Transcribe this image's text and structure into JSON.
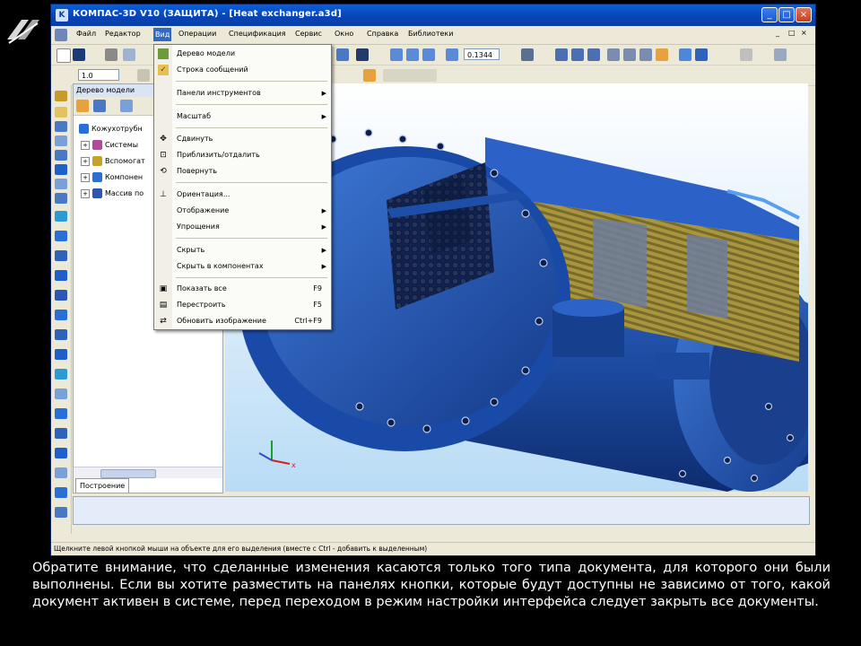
{
  "window": {
    "title": "КОМПАС-3D V10 (ЗАЩИТА) - [Heat exchanger.a3d]",
    "controls": [
      "_",
      "□",
      "×"
    ]
  },
  "menubar": {
    "items": [
      {
        "label": "Файл"
      },
      {
        "label": "Редактор"
      },
      {
        "label": "Вид"
      },
      {
        "label": "Операции"
      },
      {
        "label": "Спецификация"
      },
      {
        "label": "Сервис"
      },
      {
        "label": "Окно"
      },
      {
        "label": "Справка"
      },
      {
        "label": "Библиотеки"
      }
    ],
    "mdi_controls": [
      "_",
      "□",
      "×"
    ]
  },
  "toolbar": {
    "scale_value": "0.1344",
    "step_value": "1.0"
  },
  "tree_panel": {
    "title": "Дерево модели",
    "root": "Кожухотрубн",
    "nodes": [
      {
        "label": "Системы",
        "icon_color": "#b04a9a"
      },
      {
        "label": "Вспомогат",
        "icon_color": "#c7a12a"
      },
      {
        "label": "Компонен",
        "icon_color": "#2a6fd6"
      },
      {
        "label": "Массив по",
        "icon_color": "#2d55b3"
      }
    ],
    "tab": "Построение"
  },
  "view_menu": {
    "groups": [
      [
        {
          "label": "Дерево модели",
          "icon": "tree-icon",
          "checked": false
        },
        {
          "label": "Строка сообщений",
          "icon": "check-icon",
          "checked": true
        }
      ],
      [
        {
          "label": "Панели инструментов",
          "submenu": true
        }
      ],
      [
        {
          "label": "Масштаб",
          "submenu": true
        }
      ],
      [
        {
          "label": "Сдвинуть",
          "icon": "move-icon",
          "glyph": "✥"
        },
        {
          "label": "Приблизить/отдалить",
          "icon": "zoom-icon",
          "glyph": "⊡"
        },
        {
          "label": "Повернуть",
          "icon": "rotate-icon",
          "glyph": "⟲"
        }
      ],
      [
        {
          "label": "Ориентация...",
          "icon": "axes-icon",
          "glyph": "⊥"
        },
        {
          "label": "Отображение",
          "submenu": true
        },
        {
          "label": "Упрощения",
          "submenu": true
        }
      ],
      [
        {
          "label": "Скрыть",
          "submenu": true
        },
        {
          "label": "Скрыть в компонентах",
          "submenu": true
        }
      ],
      [
        {
          "label": "Показать все",
          "shortcut": "F9",
          "icon": "show-all-icon",
          "glyph": "▣"
        },
        {
          "label": "Перестроить",
          "shortcut": "F5",
          "icon": "rebuild-icon",
          "glyph": "▤"
        },
        {
          "label": "Обновить изображение",
          "shortcut": "Ctrl+F9",
          "icon": "refresh-icon",
          "glyph": "⇄"
        }
      ]
    ]
  },
  "status_bar": {
    "text": "Щелкните левой кнопкой мыши на объекте для его выделения (вместе с Ctrl - добавить к выделенным)"
  },
  "caption": {
    "text": "Обратите внимание, что сделанные изменения касаются только того типа документа, для которого они были выполнены. Если вы хотите разместить на панелях кнопки, которые будут доступны не зависимо от того, какой документ активен в системе, перед переходом в режим настройки интерфейса следует закрыть все документы."
  },
  "colors": {
    "title_bar": "#0843b5",
    "menu_highlight": "#316ac5",
    "model_blue": "#1d4fa8",
    "tube_gold": "#9c8a3c"
  }
}
